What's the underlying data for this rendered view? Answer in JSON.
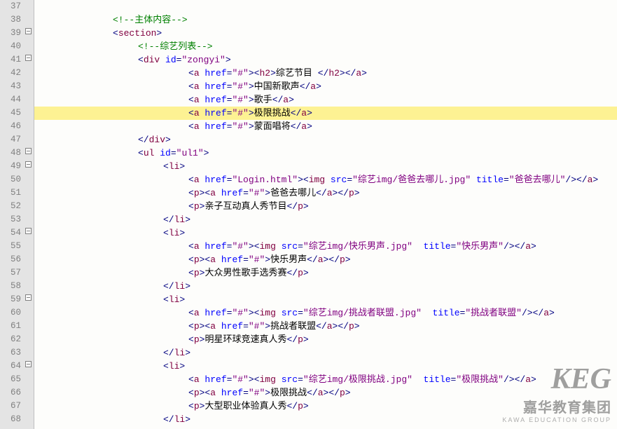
{
  "watermark": {
    "big": "KEG",
    "mid": "嘉华教育集团",
    "small": "KAWA EDUCATION GROUP"
  },
  "lines": [
    {
      "n": 37,
      "fold": "",
      "hl": false,
      "indent": 0,
      "tokens": []
    },
    {
      "n": 38,
      "fold": "",
      "hl": false,
      "indent": 3,
      "tokens": [
        {
          "c": "cm",
          "t": "<!--主体内容-->"
        }
      ]
    },
    {
      "n": 39,
      "fold": "box",
      "hl": false,
      "indent": 3,
      "tokens": [
        {
          "c": "br",
          "t": "<"
        },
        {
          "c": "tg",
          "t": "section"
        },
        {
          "c": "br",
          "t": ">"
        }
      ]
    },
    {
      "n": 40,
      "fold": "",
      "hl": false,
      "indent": 4,
      "tokens": [
        {
          "c": "cm",
          "t": "<!--综艺列表-->"
        }
      ]
    },
    {
      "n": 41,
      "fold": "box",
      "hl": false,
      "indent": 4,
      "tokens": [
        {
          "c": "br",
          "t": "<"
        },
        {
          "c": "tg",
          "t": "div "
        },
        {
          "c": "an",
          "t": "id"
        },
        {
          "c": "pu",
          "t": "="
        },
        {
          "c": "vl",
          "t": "\"zongyi\""
        },
        {
          "c": "br",
          "t": ">"
        }
      ]
    },
    {
      "n": 42,
      "fold": "",
      "hl": false,
      "indent": 6,
      "tokens": [
        {
          "c": "br",
          "t": "<"
        },
        {
          "c": "tg",
          "t": "a "
        },
        {
          "c": "an",
          "t": "href"
        },
        {
          "c": "pu",
          "t": "="
        },
        {
          "c": "vl",
          "t": "\"#\""
        },
        {
          "c": "br",
          "t": "><"
        },
        {
          "c": "tg",
          "t": "h2"
        },
        {
          "c": "br",
          "t": ">"
        },
        {
          "c": "tx",
          "t": "综艺节目 "
        },
        {
          "c": "br",
          "t": "</"
        },
        {
          "c": "tg",
          "t": "h2"
        },
        {
          "c": "br",
          "t": "></"
        },
        {
          "c": "tg",
          "t": "a"
        },
        {
          "c": "br",
          "t": ">"
        }
      ]
    },
    {
      "n": 43,
      "fold": "",
      "hl": false,
      "indent": 6,
      "tokens": [
        {
          "c": "br",
          "t": "<"
        },
        {
          "c": "tg",
          "t": "a "
        },
        {
          "c": "an",
          "t": "href"
        },
        {
          "c": "pu",
          "t": "="
        },
        {
          "c": "vl",
          "t": "\"#\""
        },
        {
          "c": "br",
          "t": ">"
        },
        {
          "c": "tx",
          "t": "中国新歌声"
        },
        {
          "c": "br",
          "t": "</"
        },
        {
          "c": "tg",
          "t": "a"
        },
        {
          "c": "br",
          "t": ">"
        }
      ]
    },
    {
      "n": 44,
      "fold": "",
      "hl": false,
      "indent": 6,
      "tokens": [
        {
          "c": "br",
          "t": "<"
        },
        {
          "c": "tg",
          "t": "a "
        },
        {
          "c": "an",
          "t": "href"
        },
        {
          "c": "pu",
          "t": "="
        },
        {
          "c": "vl",
          "t": "\"#\""
        },
        {
          "c": "br",
          "t": ">"
        },
        {
          "c": "tx",
          "t": "歌手"
        },
        {
          "c": "br",
          "t": "</"
        },
        {
          "c": "tg",
          "t": "a"
        },
        {
          "c": "br",
          "t": ">"
        }
      ]
    },
    {
      "n": 45,
      "fold": "",
      "hl": true,
      "indent": 6,
      "tokens": [
        {
          "c": "br",
          "t": "<"
        },
        {
          "c": "tg",
          "t": "a "
        },
        {
          "c": "an",
          "t": "href"
        },
        {
          "c": "pu",
          "t": "="
        },
        {
          "c": "vl",
          "t": "\"#\""
        },
        {
          "c": "br",
          "t": ">"
        },
        {
          "c": "tx",
          "t": "极限挑战"
        },
        {
          "c": "br",
          "t": "</"
        },
        {
          "c": "tg",
          "t": "a"
        },
        {
          "c": "br",
          "t": ">"
        }
      ]
    },
    {
      "n": 46,
      "fold": "",
      "hl": false,
      "indent": 6,
      "tokens": [
        {
          "c": "br",
          "t": "<"
        },
        {
          "c": "tg",
          "t": "a "
        },
        {
          "c": "an",
          "t": "href"
        },
        {
          "c": "pu",
          "t": "="
        },
        {
          "c": "vl",
          "t": "\"#\""
        },
        {
          "c": "br",
          "t": ">"
        },
        {
          "c": "tx",
          "t": "蒙面唱将"
        },
        {
          "c": "br",
          "t": "</"
        },
        {
          "c": "tg",
          "t": "a"
        },
        {
          "c": "br",
          "t": ">"
        }
      ]
    },
    {
      "n": 47,
      "fold": "",
      "hl": false,
      "indent": 4,
      "tokens": [
        {
          "c": "br",
          "t": "</"
        },
        {
          "c": "tg",
          "t": "div"
        },
        {
          "c": "br",
          "t": ">"
        }
      ]
    },
    {
      "n": 48,
      "fold": "box",
      "hl": false,
      "indent": 4,
      "tokens": [
        {
          "c": "br",
          "t": "<"
        },
        {
          "c": "tg",
          "t": "ul "
        },
        {
          "c": "an",
          "t": "id"
        },
        {
          "c": "pu",
          "t": "="
        },
        {
          "c": "vl",
          "t": "\"ul1\""
        },
        {
          "c": "br",
          "t": ">"
        }
      ]
    },
    {
      "n": 49,
      "fold": "box",
      "hl": false,
      "indent": 5,
      "tokens": [
        {
          "c": "br",
          "t": "<"
        },
        {
          "c": "tg",
          "t": "li"
        },
        {
          "c": "br",
          "t": ">"
        }
      ]
    },
    {
      "n": 50,
      "fold": "",
      "hl": false,
      "indent": 6,
      "tokens": [
        {
          "c": "br",
          "t": "<"
        },
        {
          "c": "tg",
          "t": "a "
        },
        {
          "c": "an",
          "t": "href"
        },
        {
          "c": "pu",
          "t": "="
        },
        {
          "c": "vl",
          "t": "\"Login.html\""
        },
        {
          "c": "br",
          "t": "><"
        },
        {
          "c": "tg",
          "t": "img "
        },
        {
          "c": "an",
          "t": "src"
        },
        {
          "c": "pu",
          "t": "="
        },
        {
          "c": "vl",
          "t": "\"综艺img/爸爸去哪儿.jpg\""
        },
        {
          "c": "tx",
          "t": " "
        },
        {
          "c": "an",
          "t": "title"
        },
        {
          "c": "pu",
          "t": "="
        },
        {
          "c": "vl",
          "t": "\"爸爸去哪儿\""
        },
        {
          "c": "br",
          "t": "/></"
        },
        {
          "c": "tg",
          "t": "a"
        },
        {
          "c": "br",
          "t": ">"
        }
      ]
    },
    {
      "n": 51,
      "fold": "",
      "hl": false,
      "indent": 6,
      "tokens": [
        {
          "c": "br",
          "t": "<"
        },
        {
          "c": "tg",
          "t": "p"
        },
        {
          "c": "br",
          "t": "><"
        },
        {
          "c": "tg",
          "t": "a "
        },
        {
          "c": "an",
          "t": "href"
        },
        {
          "c": "pu",
          "t": "="
        },
        {
          "c": "vl",
          "t": "\"#\""
        },
        {
          "c": "br",
          "t": ">"
        },
        {
          "c": "tx",
          "t": "爸爸去哪儿"
        },
        {
          "c": "br",
          "t": "</"
        },
        {
          "c": "tg",
          "t": "a"
        },
        {
          "c": "br",
          "t": "></"
        },
        {
          "c": "tg",
          "t": "p"
        },
        {
          "c": "br",
          "t": ">"
        }
      ]
    },
    {
      "n": 52,
      "fold": "",
      "hl": false,
      "indent": 6,
      "tokens": [
        {
          "c": "br",
          "t": "<"
        },
        {
          "c": "tg",
          "t": "p"
        },
        {
          "c": "br",
          "t": ">"
        },
        {
          "c": "tx",
          "t": "亲子互动真人秀节目"
        },
        {
          "c": "br",
          "t": "</"
        },
        {
          "c": "tg",
          "t": "p"
        },
        {
          "c": "br",
          "t": ">"
        }
      ]
    },
    {
      "n": 53,
      "fold": "",
      "hl": false,
      "indent": 5,
      "tokens": [
        {
          "c": "br",
          "t": "</"
        },
        {
          "c": "tg",
          "t": "li"
        },
        {
          "c": "br",
          "t": ">"
        }
      ]
    },
    {
      "n": 54,
      "fold": "box",
      "hl": false,
      "indent": 5,
      "tokens": [
        {
          "c": "br",
          "t": "<"
        },
        {
          "c": "tg",
          "t": "li"
        },
        {
          "c": "br",
          "t": ">"
        }
      ]
    },
    {
      "n": 55,
      "fold": "",
      "hl": false,
      "indent": 6,
      "tokens": [
        {
          "c": "br",
          "t": "<"
        },
        {
          "c": "tg",
          "t": "a "
        },
        {
          "c": "an",
          "t": "href"
        },
        {
          "c": "pu",
          "t": "="
        },
        {
          "c": "vl",
          "t": "\"#\""
        },
        {
          "c": "br",
          "t": "><"
        },
        {
          "c": "tg",
          "t": "img "
        },
        {
          "c": "an",
          "t": "src"
        },
        {
          "c": "pu",
          "t": "="
        },
        {
          "c": "vl",
          "t": "\"综艺img/快乐男声.jpg\""
        },
        {
          "c": "tx",
          "t": "  "
        },
        {
          "c": "an",
          "t": "title"
        },
        {
          "c": "pu",
          "t": "="
        },
        {
          "c": "vl",
          "t": "\"快乐男声\""
        },
        {
          "c": "br",
          "t": "/></"
        },
        {
          "c": "tg",
          "t": "a"
        },
        {
          "c": "br",
          "t": ">"
        }
      ]
    },
    {
      "n": 56,
      "fold": "",
      "hl": false,
      "indent": 6,
      "tokens": [
        {
          "c": "br",
          "t": "<"
        },
        {
          "c": "tg",
          "t": "p"
        },
        {
          "c": "br",
          "t": "><"
        },
        {
          "c": "tg",
          "t": "a "
        },
        {
          "c": "an",
          "t": "href"
        },
        {
          "c": "pu",
          "t": "="
        },
        {
          "c": "vl",
          "t": "\"#\""
        },
        {
          "c": "br",
          "t": ">"
        },
        {
          "c": "tx",
          "t": "快乐男声"
        },
        {
          "c": "br",
          "t": "</"
        },
        {
          "c": "tg",
          "t": "a"
        },
        {
          "c": "br",
          "t": "></"
        },
        {
          "c": "tg",
          "t": "p"
        },
        {
          "c": "br",
          "t": ">"
        }
      ]
    },
    {
      "n": 57,
      "fold": "",
      "hl": false,
      "indent": 6,
      "tokens": [
        {
          "c": "br",
          "t": "<"
        },
        {
          "c": "tg",
          "t": "p"
        },
        {
          "c": "br",
          "t": ">"
        },
        {
          "c": "tx",
          "t": "大众男性歌手选秀赛"
        },
        {
          "c": "br",
          "t": "</"
        },
        {
          "c": "tg",
          "t": "p"
        },
        {
          "c": "br",
          "t": ">"
        }
      ]
    },
    {
      "n": 58,
      "fold": "",
      "hl": false,
      "indent": 5,
      "tokens": [
        {
          "c": "br",
          "t": "</"
        },
        {
          "c": "tg",
          "t": "li"
        },
        {
          "c": "br",
          "t": ">"
        }
      ]
    },
    {
      "n": 59,
      "fold": "box",
      "hl": false,
      "indent": 5,
      "tokens": [
        {
          "c": "br",
          "t": "<"
        },
        {
          "c": "tg",
          "t": "li"
        },
        {
          "c": "br",
          "t": ">"
        }
      ]
    },
    {
      "n": 60,
      "fold": "",
      "hl": false,
      "indent": 6,
      "tokens": [
        {
          "c": "br",
          "t": "<"
        },
        {
          "c": "tg",
          "t": "a "
        },
        {
          "c": "an",
          "t": "href"
        },
        {
          "c": "pu",
          "t": "="
        },
        {
          "c": "vl",
          "t": "\"#\""
        },
        {
          "c": "br",
          "t": "><"
        },
        {
          "c": "tg",
          "t": "img "
        },
        {
          "c": "an",
          "t": "src"
        },
        {
          "c": "pu",
          "t": "="
        },
        {
          "c": "vl",
          "t": "\"综艺img/挑战者联盟.jpg\""
        },
        {
          "c": "tx",
          "t": "  "
        },
        {
          "c": "an",
          "t": "title"
        },
        {
          "c": "pu",
          "t": "="
        },
        {
          "c": "vl",
          "t": "\"挑战者联盟\""
        },
        {
          "c": "br",
          "t": "/></"
        },
        {
          "c": "tg",
          "t": "a"
        },
        {
          "c": "br",
          "t": ">"
        }
      ]
    },
    {
      "n": 61,
      "fold": "",
      "hl": false,
      "indent": 6,
      "tokens": [
        {
          "c": "br",
          "t": "<"
        },
        {
          "c": "tg",
          "t": "p"
        },
        {
          "c": "br",
          "t": "><"
        },
        {
          "c": "tg",
          "t": "a "
        },
        {
          "c": "an",
          "t": "href"
        },
        {
          "c": "pu",
          "t": "="
        },
        {
          "c": "vl",
          "t": "\"#\""
        },
        {
          "c": "br",
          "t": ">"
        },
        {
          "c": "tx",
          "t": "挑战者联盟"
        },
        {
          "c": "br",
          "t": "</"
        },
        {
          "c": "tg",
          "t": "a"
        },
        {
          "c": "br",
          "t": "></"
        },
        {
          "c": "tg",
          "t": "p"
        },
        {
          "c": "br",
          "t": ">"
        }
      ]
    },
    {
      "n": 62,
      "fold": "",
      "hl": false,
      "indent": 6,
      "tokens": [
        {
          "c": "br",
          "t": "<"
        },
        {
          "c": "tg",
          "t": "p"
        },
        {
          "c": "br",
          "t": ">"
        },
        {
          "c": "tx",
          "t": "明星环球竞速真人秀"
        },
        {
          "c": "br",
          "t": "</"
        },
        {
          "c": "tg",
          "t": "p"
        },
        {
          "c": "br",
          "t": ">"
        }
      ]
    },
    {
      "n": 63,
      "fold": "",
      "hl": false,
      "indent": 5,
      "tokens": [
        {
          "c": "br",
          "t": "</"
        },
        {
          "c": "tg",
          "t": "li"
        },
        {
          "c": "br",
          "t": ">"
        }
      ]
    },
    {
      "n": 64,
      "fold": "box",
      "hl": false,
      "indent": 5,
      "tokens": [
        {
          "c": "br",
          "t": "<"
        },
        {
          "c": "tg",
          "t": "li"
        },
        {
          "c": "br",
          "t": ">"
        }
      ]
    },
    {
      "n": 65,
      "fold": "",
      "hl": false,
      "indent": 6,
      "tokens": [
        {
          "c": "br",
          "t": "<"
        },
        {
          "c": "tg",
          "t": "a "
        },
        {
          "c": "an",
          "t": "href"
        },
        {
          "c": "pu",
          "t": "="
        },
        {
          "c": "vl",
          "t": "\"#\""
        },
        {
          "c": "br",
          "t": "><"
        },
        {
          "c": "tg",
          "t": "img "
        },
        {
          "c": "an",
          "t": "src"
        },
        {
          "c": "pu",
          "t": "="
        },
        {
          "c": "vl",
          "t": "\"综艺img/极限挑战.jpg\""
        },
        {
          "c": "tx",
          "t": "  "
        },
        {
          "c": "an",
          "t": "title"
        },
        {
          "c": "pu",
          "t": "="
        },
        {
          "c": "vl",
          "t": "\"极限挑战\""
        },
        {
          "c": "br",
          "t": "/></"
        },
        {
          "c": "tg",
          "t": "a"
        },
        {
          "c": "br",
          "t": ">"
        }
      ]
    },
    {
      "n": 66,
      "fold": "",
      "hl": false,
      "indent": 6,
      "tokens": [
        {
          "c": "br",
          "t": "<"
        },
        {
          "c": "tg",
          "t": "p"
        },
        {
          "c": "br",
          "t": "><"
        },
        {
          "c": "tg",
          "t": "a "
        },
        {
          "c": "an",
          "t": "href"
        },
        {
          "c": "pu",
          "t": "="
        },
        {
          "c": "vl",
          "t": "\"#\""
        },
        {
          "c": "br",
          "t": ">"
        },
        {
          "c": "tx",
          "t": "极限挑战"
        },
        {
          "c": "br",
          "t": "</"
        },
        {
          "c": "tg",
          "t": "a"
        },
        {
          "c": "br",
          "t": "></"
        },
        {
          "c": "tg",
          "t": "p"
        },
        {
          "c": "br",
          "t": ">"
        }
      ]
    },
    {
      "n": 67,
      "fold": "",
      "hl": false,
      "indent": 6,
      "tokens": [
        {
          "c": "br",
          "t": "<"
        },
        {
          "c": "tg",
          "t": "p"
        },
        {
          "c": "br",
          "t": ">"
        },
        {
          "c": "tx",
          "t": "大型职业体验真人秀"
        },
        {
          "c": "br",
          "t": "</"
        },
        {
          "c": "tg",
          "t": "p"
        },
        {
          "c": "br",
          "t": ">"
        }
      ]
    },
    {
      "n": 68,
      "fold": "",
      "hl": false,
      "indent": 5,
      "tokens": [
        {
          "c": "br",
          "t": "</"
        },
        {
          "c": "tg",
          "t": "li"
        },
        {
          "c": "br",
          "t": ">"
        }
      ]
    }
  ]
}
